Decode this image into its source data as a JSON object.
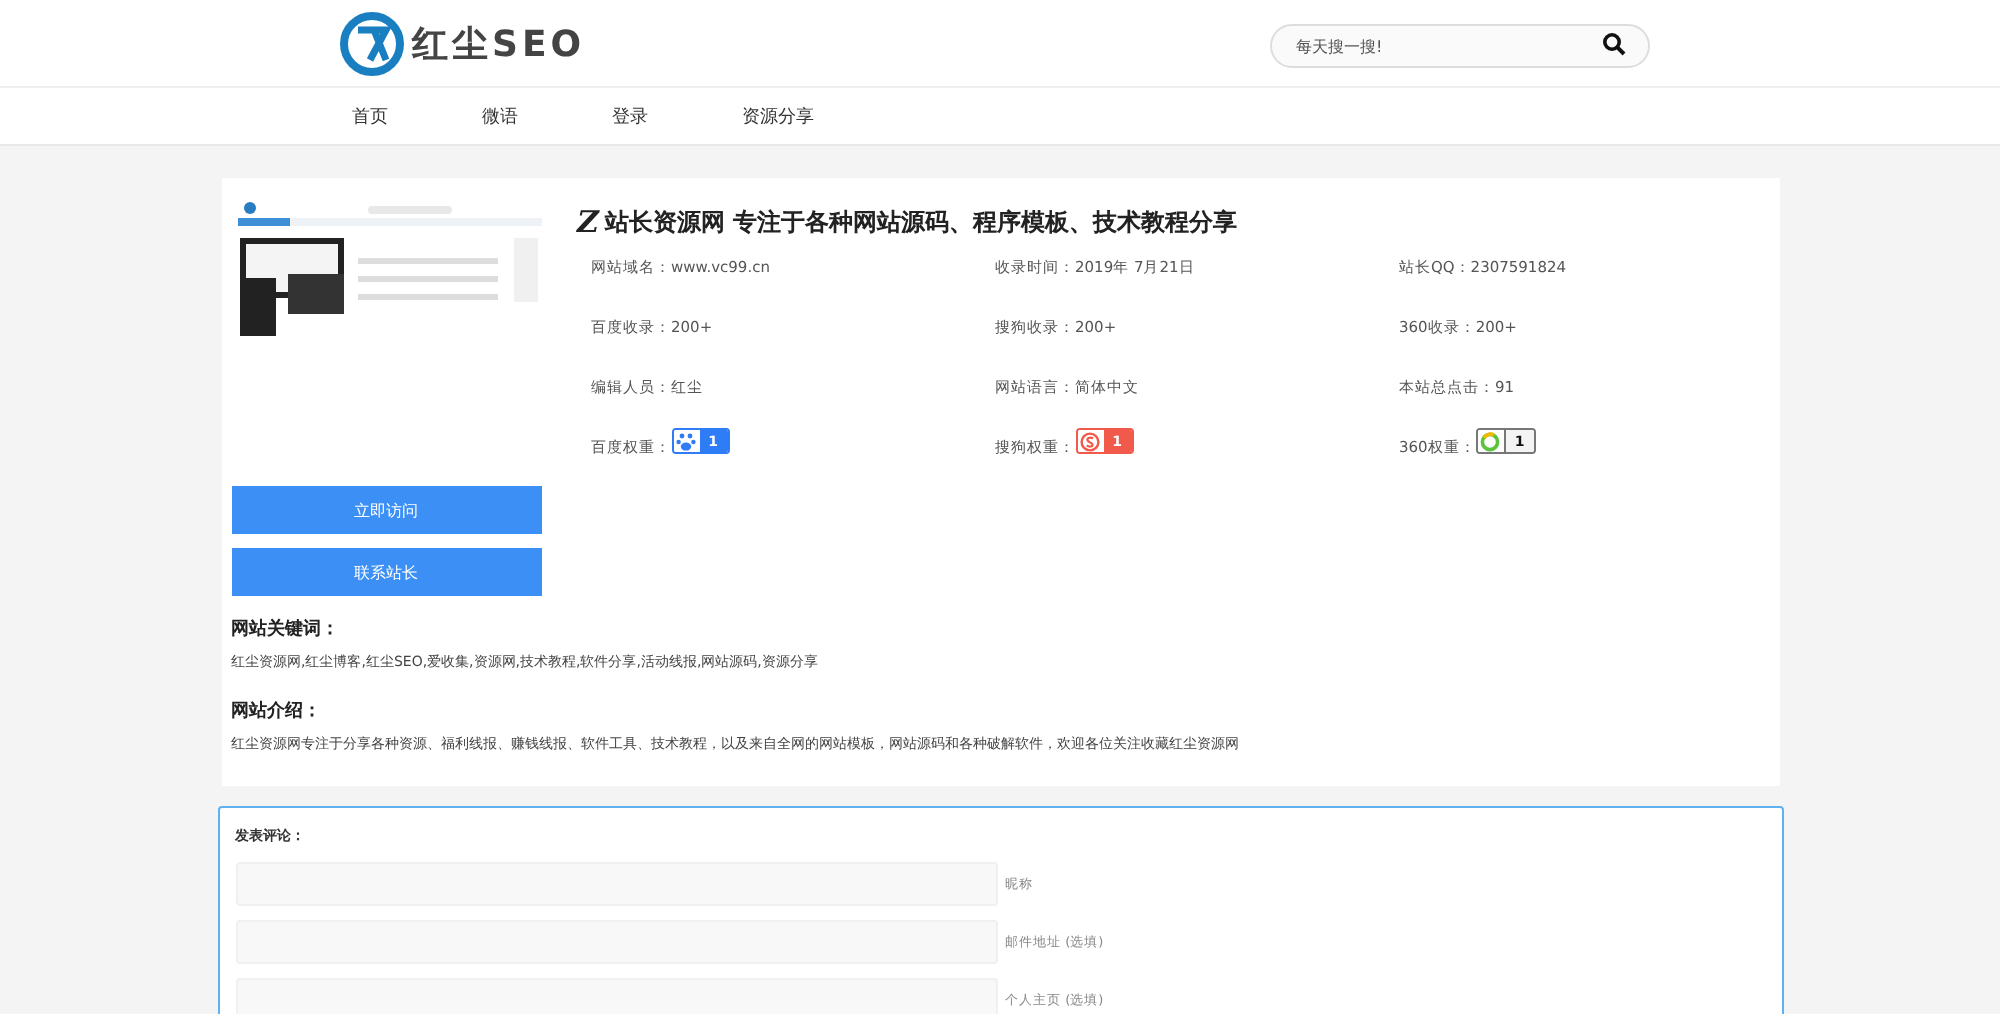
{
  "header": {
    "logo_text": "红尘SEO",
    "search": {
      "placeholder": "每天搜一搜!"
    }
  },
  "nav": [
    "首页",
    "微语",
    "登录",
    "资源分享"
  ],
  "site": {
    "thumbnail": {
      "kind": "picture"
    },
    "buttons": [
      "立即访问",
      "联系站长"
    ],
    "title_mark": "Z",
    "title": "站长资源网 专注于各种网站源码、程序模板、技术教程分享",
    "info": [
      {
        "label": "网站域名：",
        "value": "www.vc99.cn"
      },
      {
        "label": "收录时间：",
        "value": "2019年 7月21日"
      },
      {
        "label": "站长QQ：",
        "value": "2307591824"
      },
      {
        "label": "百度收录：",
        "value": "200+"
      },
      {
        "label": "搜狗收录：",
        "value": "200+"
      },
      {
        "label": "360收录：",
        "value": "200+"
      },
      {
        "label": "编辑人员：",
        "value": "红尘"
      },
      {
        "label": "网站语言：",
        "value": "简体中文"
      },
      {
        "label": "本站总点击：",
        "value": "91"
      }
    ],
    "weights": [
      {
        "label": "百度权重：",
        "kind": "baidu",
        "value": "1"
      },
      {
        "label": "搜狗权重：",
        "kind": "sogou",
        "value": "1"
      },
      {
        "label": "360权重：",
        "kind": "qihoo",
        "value": "1"
      }
    ],
    "keywords_heading": "网站关键词：",
    "keywords": "红尘资源网,红尘博客,红尘SEO,爱收集,资源网,技术教程,软件分享,活动线报,网站源码,资源分享",
    "intro_heading": "网站介绍：",
    "intro": "红尘资源网专注于分享各种资源、福利线报、赚钱线报、软件工具、技术教程，以及来自全网的网站模板，网站源码和各种破解软件，欢迎各位关注收藏红尘资源网"
  },
  "comment": {
    "title": "发表评论：",
    "fields": [
      {
        "label": "昵称"
      },
      {
        "label": "邮件地址 (选填)"
      },
      {
        "label": "个人主页 (选填)"
      }
    ]
  }
}
